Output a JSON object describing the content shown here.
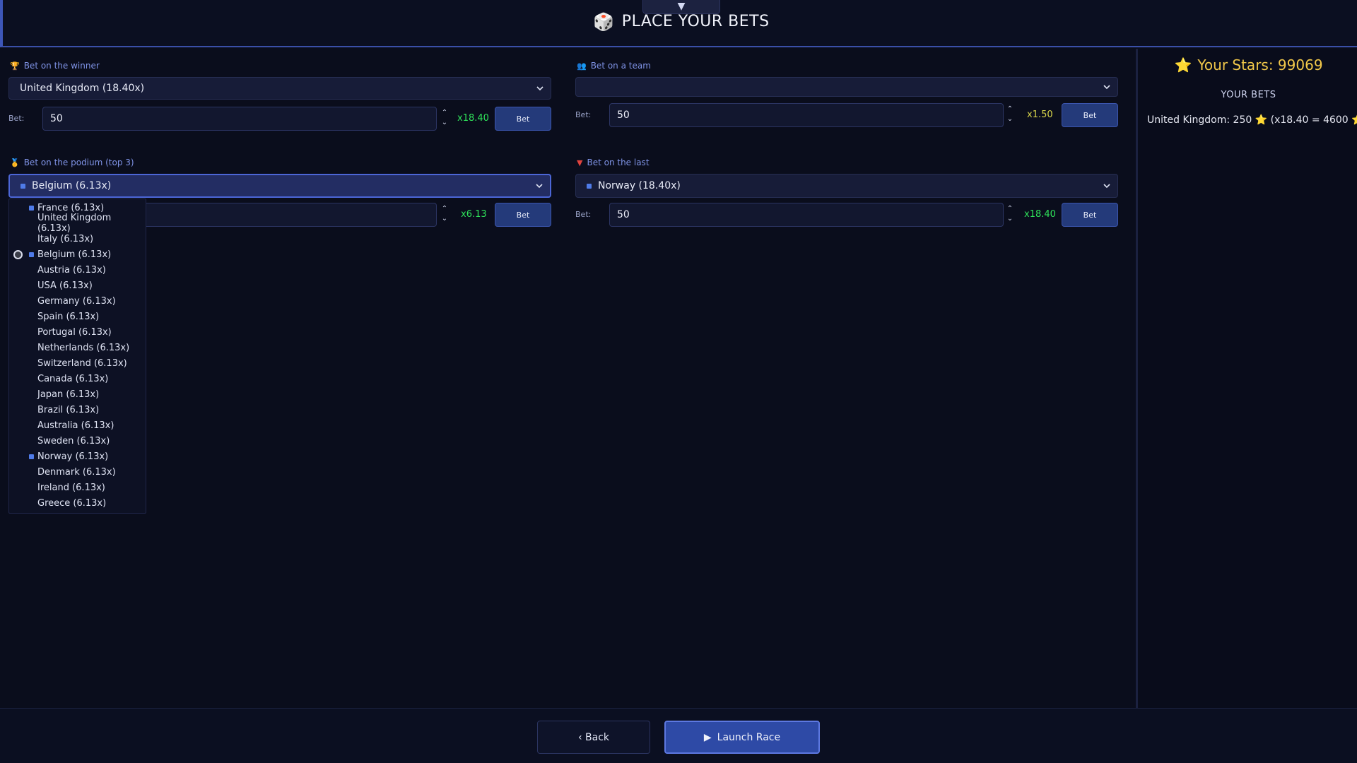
{
  "header": {
    "collapse_symbol": "▼",
    "title": "PLACE YOUR BETS",
    "icon": "dice-icon"
  },
  "winner": {
    "label": "Bet on the winner",
    "selected": "United Kingdom (18.40x)",
    "bet_label": "Bet:",
    "bet_value": "50",
    "multiplier": "x18.40",
    "button": "Bet"
  },
  "team": {
    "label": "Bet on a team",
    "selected": "",
    "bet_label": "Bet:",
    "bet_value": "50",
    "multiplier": "x1.50",
    "button": "Bet"
  },
  "podium": {
    "label": "Bet on the podium (top 3)",
    "selected": "Belgium (6.13x)",
    "multiplier": "x6.13",
    "button": "Bet",
    "options": [
      {
        "label": "France (6.13x)",
        "flag": true,
        "radio": false
      },
      {
        "label": "United Kingdom (6.13x)",
        "flag": false,
        "radio": false
      },
      {
        "label": "Italy (6.13x)",
        "flag": false,
        "radio": false
      },
      {
        "label": "Belgium (6.13x)",
        "flag": true,
        "radio": true
      },
      {
        "label": "Austria (6.13x)",
        "flag": false,
        "radio": false
      },
      {
        "label": "USA (6.13x)",
        "flag": false,
        "radio": false
      },
      {
        "label": "Germany (6.13x)",
        "flag": false,
        "radio": false
      },
      {
        "label": "Spain (6.13x)",
        "flag": false,
        "radio": false
      },
      {
        "label": "Portugal (6.13x)",
        "flag": false,
        "radio": false
      },
      {
        "label": "Netherlands (6.13x)",
        "flag": false,
        "radio": false
      },
      {
        "label": "Switzerland (6.13x)",
        "flag": false,
        "radio": false
      },
      {
        "label": "Canada (6.13x)",
        "flag": false,
        "radio": false
      },
      {
        "label": "Japan (6.13x)",
        "flag": false,
        "radio": false
      },
      {
        "label": "Brazil (6.13x)",
        "flag": false,
        "radio": false
      },
      {
        "label": "Australia (6.13x)",
        "flag": false,
        "radio": false
      },
      {
        "label": "Sweden (6.13x)",
        "flag": false,
        "radio": false
      },
      {
        "label": "Norway (6.13x)",
        "flag": true,
        "radio": false
      },
      {
        "label": "Denmark (6.13x)",
        "flag": false,
        "radio": false
      },
      {
        "label": "Ireland (6.13x)",
        "flag": false,
        "radio": false
      },
      {
        "label": "Greece (6.13x)",
        "flag": false,
        "radio": false
      }
    ]
  },
  "last": {
    "label": "Bet on the last",
    "selected": "Norway (18.40x)",
    "bet_label": "Bet:",
    "bet_value": "50",
    "multiplier": "x18.40",
    "button": "Bet"
  },
  "sidebar": {
    "stars_label": "Your Stars: 99069",
    "your_bets_title": "YOUR BETS",
    "bets": [
      {
        "prefix": "United Kingdom: 250",
        "detail": "(x18.40 = 4600",
        "suffix": ")"
      }
    ]
  },
  "footer": {
    "back_label": "‹ Back",
    "launch_label": "Launch Race"
  },
  "colors": {
    "accent": "#3d56b8",
    "multiplier_green": "#2fe35a",
    "multiplier_yellow": "#d7d44a",
    "star": "#f3c94a"
  }
}
